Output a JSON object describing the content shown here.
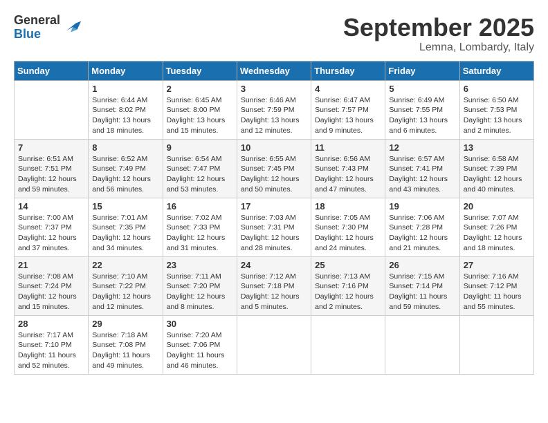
{
  "logo": {
    "general": "General",
    "blue": "Blue"
  },
  "title": {
    "month": "September 2025",
    "location": "Lemna, Lombardy, Italy"
  },
  "columns": [
    "Sunday",
    "Monday",
    "Tuesday",
    "Wednesday",
    "Thursday",
    "Friday",
    "Saturday"
  ],
  "weeks": [
    [
      {
        "day": "",
        "info": ""
      },
      {
        "day": "1",
        "info": "Sunrise: 6:44 AM\nSunset: 8:02 PM\nDaylight: 13 hours\nand 18 minutes."
      },
      {
        "day": "2",
        "info": "Sunrise: 6:45 AM\nSunset: 8:00 PM\nDaylight: 13 hours\nand 15 minutes."
      },
      {
        "day": "3",
        "info": "Sunrise: 6:46 AM\nSunset: 7:59 PM\nDaylight: 13 hours\nand 12 minutes."
      },
      {
        "day": "4",
        "info": "Sunrise: 6:47 AM\nSunset: 7:57 PM\nDaylight: 13 hours\nand 9 minutes."
      },
      {
        "day": "5",
        "info": "Sunrise: 6:49 AM\nSunset: 7:55 PM\nDaylight: 13 hours\nand 6 minutes."
      },
      {
        "day": "6",
        "info": "Sunrise: 6:50 AM\nSunset: 7:53 PM\nDaylight: 13 hours\nand 2 minutes."
      }
    ],
    [
      {
        "day": "7",
        "info": "Sunrise: 6:51 AM\nSunset: 7:51 PM\nDaylight: 12 hours\nand 59 minutes."
      },
      {
        "day": "8",
        "info": "Sunrise: 6:52 AM\nSunset: 7:49 PM\nDaylight: 12 hours\nand 56 minutes."
      },
      {
        "day": "9",
        "info": "Sunrise: 6:54 AM\nSunset: 7:47 PM\nDaylight: 12 hours\nand 53 minutes."
      },
      {
        "day": "10",
        "info": "Sunrise: 6:55 AM\nSunset: 7:45 PM\nDaylight: 12 hours\nand 50 minutes."
      },
      {
        "day": "11",
        "info": "Sunrise: 6:56 AM\nSunset: 7:43 PM\nDaylight: 12 hours\nand 47 minutes."
      },
      {
        "day": "12",
        "info": "Sunrise: 6:57 AM\nSunset: 7:41 PM\nDaylight: 12 hours\nand 43 minutes."
      },
      {
        "day": "13",
        "info": "Sunrise: 6:58 AM\nSunset: 7:39 PM\nDaylight: 12 hours\nand 40 minutes."
      }
    ],
    [
      {
        "day": "14",
        "info": "Sunrise: 7:00 AM\nSunset: 7:37 PM\nDaylight: 12 hours\nand 37 minutes."
      },
      {
        "day": "15",
        "info": "Sunrise: 7:01 AM\nSunset: 7:35 PM\nDaylight: 12 hours\nand 34 minutes."
      },
      {
        "day": "16",
        "info": "Sunrise: 7:02 AM\nSunset: 7:33 PM\nDaylight: 12 hours\nand 31 minutes."
      },
      {
        "day": "17",
        "info": "Sunrise: 7:03 AM\nSunset: 7:31 PM\nDaylight: 12 hours\nand 28 minutes."
      },
      {
        "day": "18",
        "info": "Sunrise: 7:05 AM\nSunset: 7:30 PM\nDaylight: 12 hours\nand 24 minutes."
      },
      {
        "day": "19",
        "info": "Sunrise: 7:06 AM\nSunset: 7:28 PM\nDaylight: 12 hours\nand 21 minutes."
      },
      {
        "day": "20",
        "info": "Sunrise: 7:07 AM\nSunset: 7:26 PM\nDaylight: 12 hours\nand 18 minutes."
      }
    ],
    [
      {
        "day": "21",
        "info": "Sunrise: 7:08 AM\nSunset: 7:24 PM\nDaylight: 12 hours\nand 15 minutes."
      },
      {
        "day": "22",
        "info": "Sunrise: 7:10 AM\nSunset: 7:22 PM\nDaylight: 12 hours\nand 12 minutes."
      },
      {
        "day": "23",
        "info": "Sunrise: 7:11 AM\nSunset: 7:20 PM\nDaylight: 12 hours\nand 8 minutes."
      },
      {
        "day": "24",
        "info": "Sunrise: 7:12 AM\nSunset: 7:18 PM\nDaylight: 12 hours\nand 5 minutes."
      },
      {
        "day": "25",
        "info": "Sunrise: 7:13 AM\nSunset: 7:16 PM\nDaylight: 12 hours\nand 2 minutes."
      },
      {
        "day": "26",
        "info": "Sunrise: 7:15 AM\nSunset: 7:14 PM\nDaylight: 11 hours\nand 59 minutes."
      },
      {
        "day": "27",
        "info": "Sunrise: 7:16 AM\nSunset: 7:12 PM\nDaylight: 11 hours\nand 55 minutes."
      }
    ],
    [
      {
        "day": "28",
        "info": "Sunrise: 7:17 AM\nSunset: 7:10 PM\nDaylight: 11 hours\nand 52 minutes."
      },
      {
        "day": "29",
        "info": "Sunrise: 7:18 AM\nSunset: 7:08 PM\nDaylight: 11 hours\nand 49 minutes."
      },
      {
        "day": "30",
        "info": "Sunrise: 7:20 AM\nSunset: 7:06 PM\nDaylight: 11 hours\nand 46 minutes."
      },
      {
        "day": "",
        "info": ""
      },
      {
        "day": "",
        "info": ""
      },
      {
        "day": "",
        "info": ""
      },
      {
        "day": "",
        "info": ""
      }
    ]
  ]
}
